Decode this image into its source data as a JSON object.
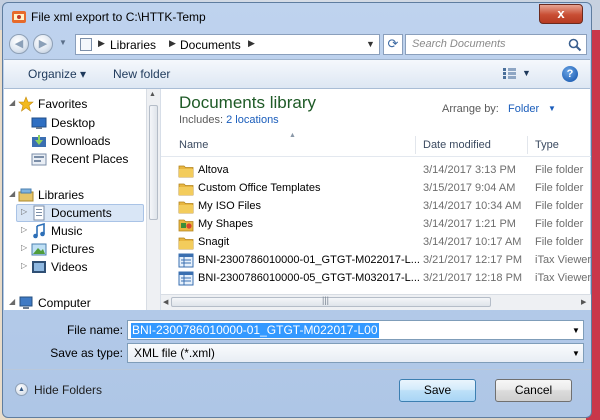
{
  "window": {
    "title": "File xml export to C:\\HTTK-Temp",
    "close_symbol": "x"
  },
  "nav": {
    "back_arrow": "◀",
    "forward_arrow": "▶",
    "breadcrumb": [
      "Libraries",
      "Documents"
    ],
    "search_placeholder": "Search Documents"
  },
  "toolbar": {
    "organize": "Organize ▾",
    "new_folder": "New folder"
  },
  "sidebar": {
    "items": [
      {
        "label": "Favorites",
        "icon": "star-icon"
      },
      {
        "label": "Desktop",
        "icon": "desktop-icon"
      },
      {
        "label": "Downloads",
        "icon": "downloads-icon"
      },
      {
        "label": "Recent Places",
        "icon": "recent-places-icon"
      },
      {
        "label": "Libraries",
        "icon": "libraries-icon"
      },
      {
        "label": "Documents",
        "icon": "documents-icon"
      },
      {
        "label": "Music",
        "icon": "music-icon"
      },
      {
        "label": "Pictures",
        "icon": "pictures-icon"
      },
      {
        "label": "Videos",
        "icon": "videos-icon"
      },
      {
        "label": "Computer",
        "icon": "computer-icon"
      }
    ],
    "selected": "Documents"
  },
  "library": {
    "title": "Documents library",
    "includes_label": "Includes:",
    "includes_link": "2 locations",
    "arrange_label": "Arrange by:",
    "arrange_value": "Folder"
  },
  "columns": {
    "name": "Name",
    "date": "Date modified",
    "type": "Type"
  },
  "files": [
    {
      "name": "Altova",
      "date": "3/14/2017 3:13 PM",
      "type": "File folder",
      "icon": "folder-icon"
    },
    {
      "name": "Custom Office Templates",
      "date": "3/15/2017 9:04 AM",
      "type": "File folder",
      "icon": "folder-icon"
    },
    {
      "name": "My ISO Files",
      "date": "3/14/2017 10:34 AM",
      "type": "File folder",
      "icon": "folder-icon"
    },
    {
      "name": "My Shapes",
      "date": "3/14/2017 1:21 PM",
      "type": "File folder",
      "icon": "shapes-folder-icon"
    },
    {
      "name": "Snagit",
      "date": "3/14/2017 10:17 AM",
      "type": "File folder",
      "icon": "folder-icon"
    },
    {
      "name": "BNI-2300786010000-01_GTGT-M022017-L...",
      "date": "3/21/2017 12:17 PM",
      "type": "iTax Viewer",
      "icon": "itax-file-icon"
    },
    {
      "name": "BNI-2300786010000-05_GTGT-M032017-L...",
      "date": "3/21/2017 12:18 PM",
      "type": "iTax Viewer",
      "icon": "itax-file-icon"
    }
  ],
  "form": {
    "file_name_label": "File name:",
    "file_name_value": "BNI-2300786010000-01_GTGT-M022017-L00",
    "save_type_label": "Save as type:",
    "save_type_value": "XML file (*.xml)"
  },
  "footer": {
    "hide_folders": "Hide Folders",
    "save": "Save",
    "cancel": "Cancel"
  },
  "colors": {
    "accent": "#1a5dbb",
    "library_title": "#1e5a26",
    "selection": "#3399ff"
  }
}
